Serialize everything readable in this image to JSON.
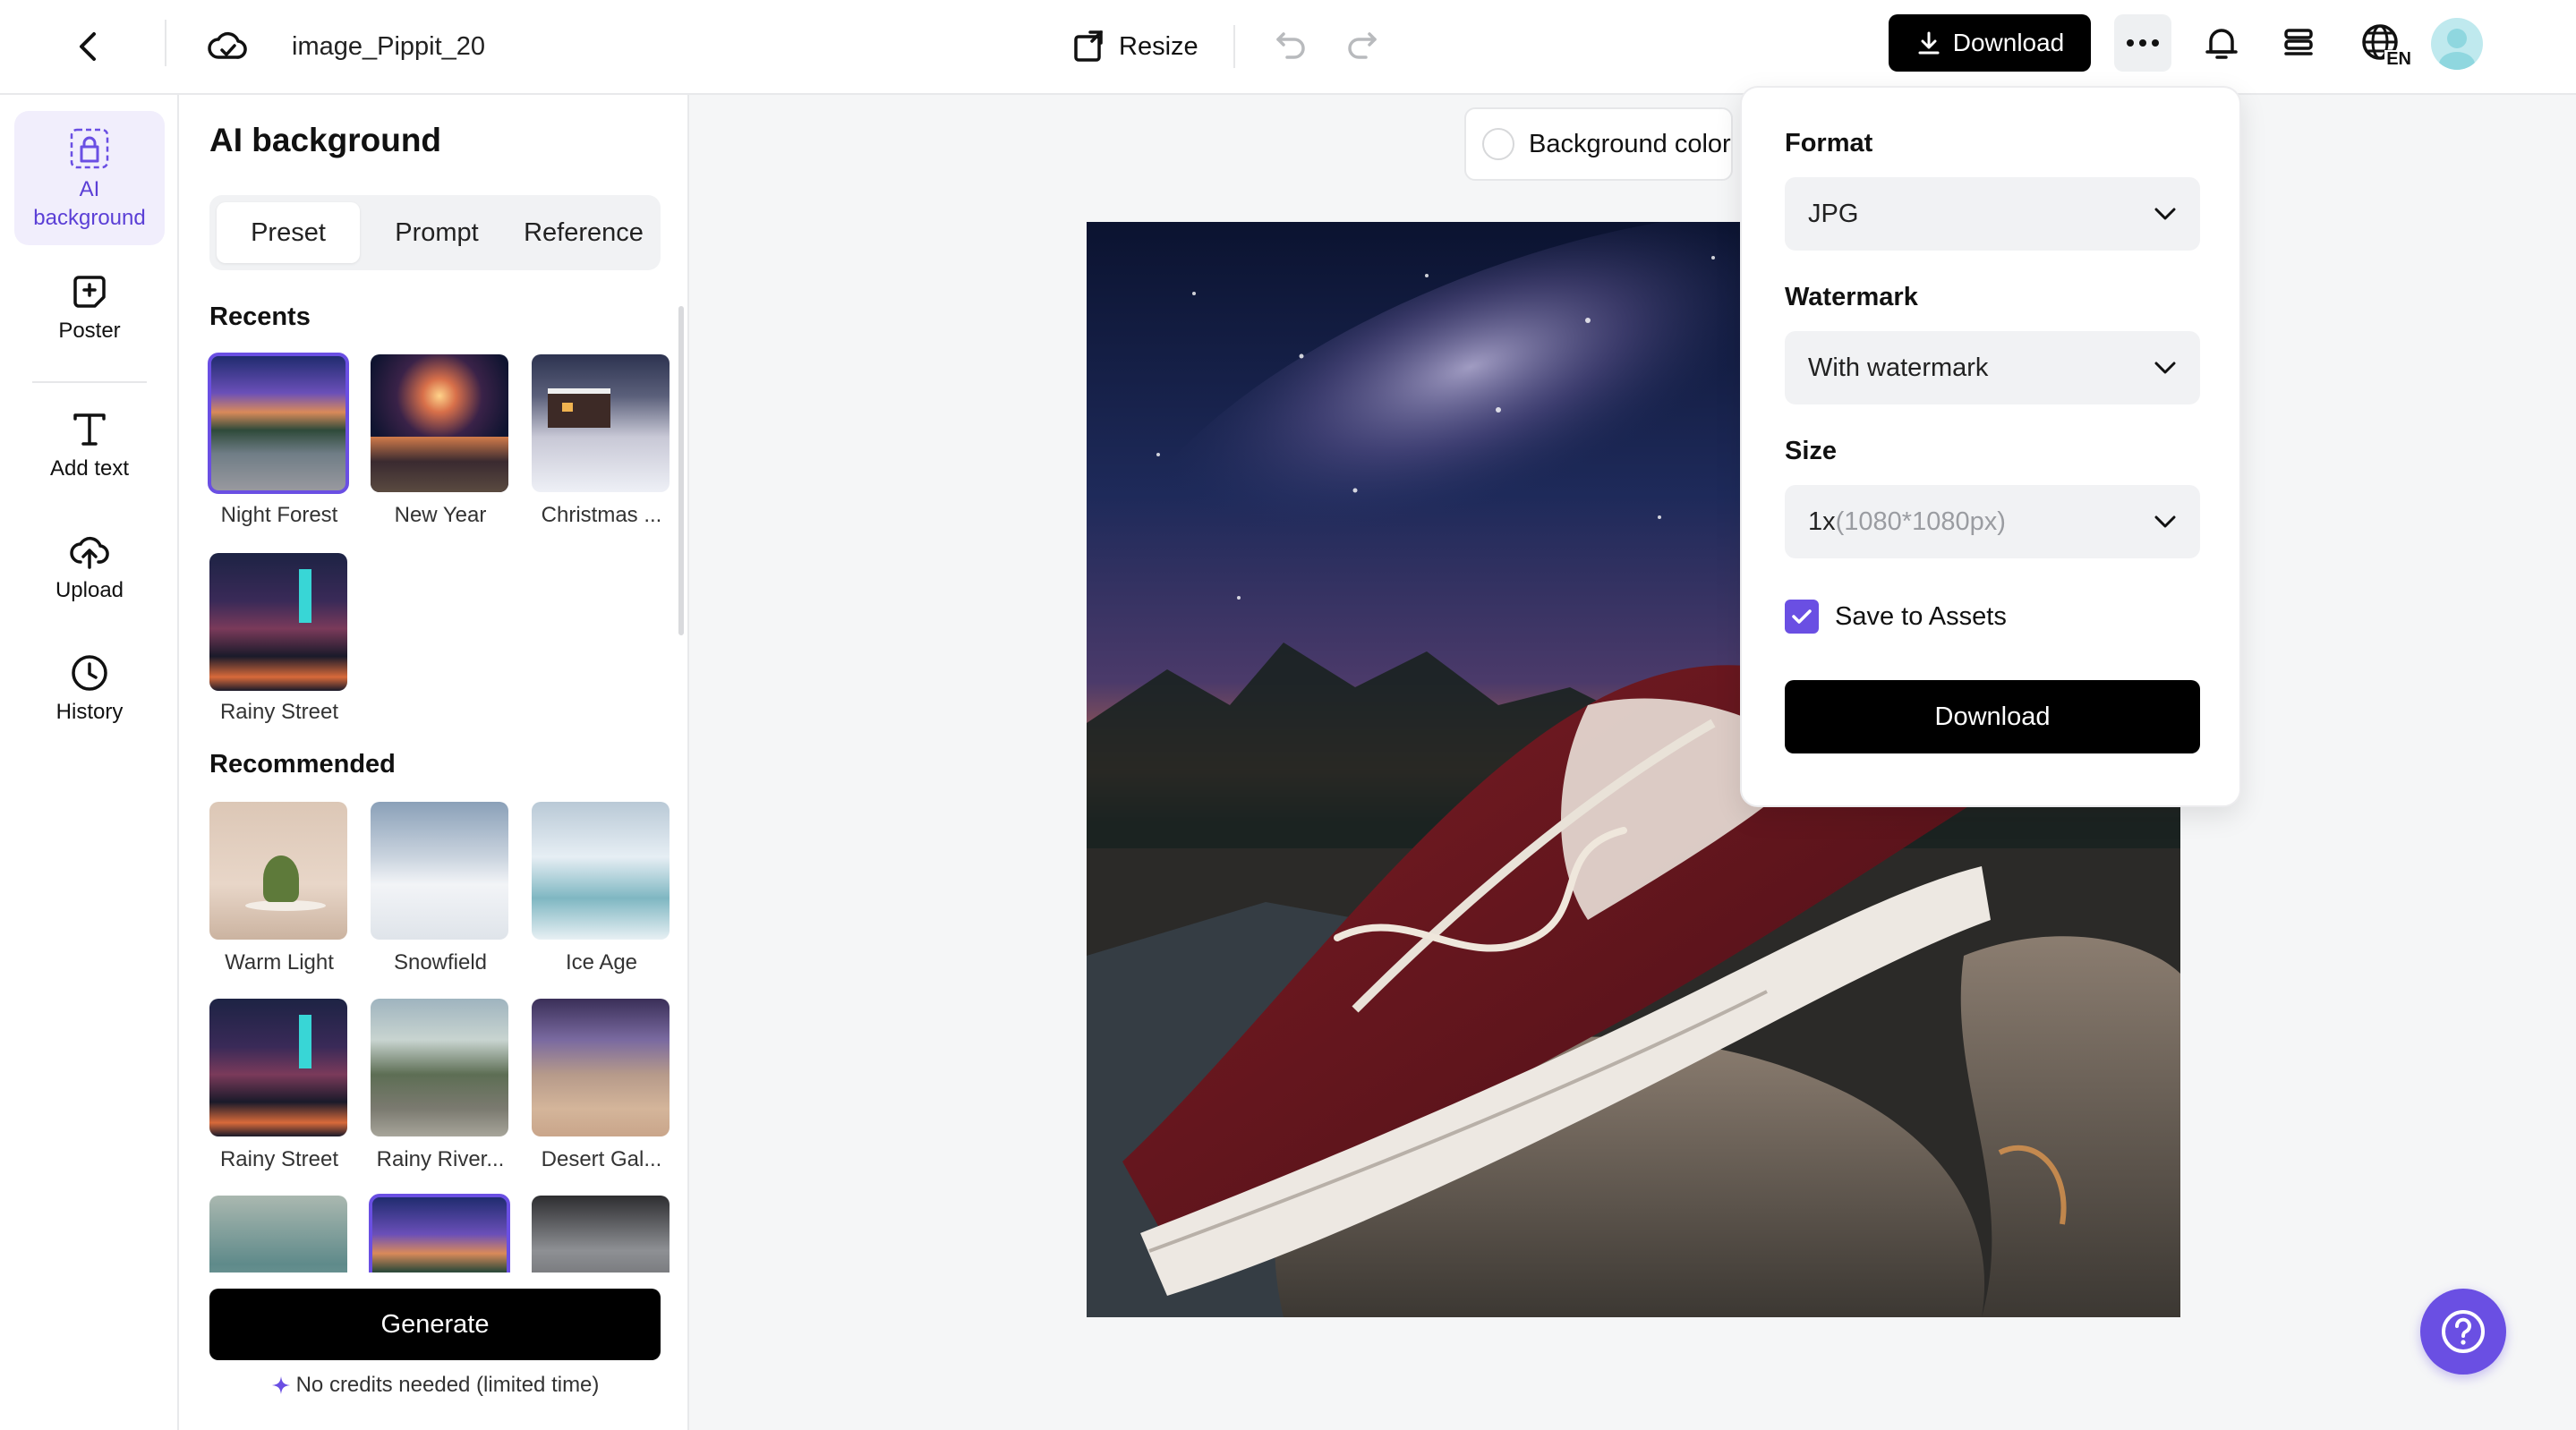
{
  "topbar": {
    "file_name": "image_Pippit_20",
    "resize_label": "Resize",
    "download_label": "Download",
    "lang_code": "EN"
  },
  "rail": {
    "items": [
      {
        "label": "AI background",
        "icon": "ai-background-icon",
        "active": true
      },
      {
        "label": "Poster",
        "icon": "poster-icon"
      },
      {
        "label": "Add text",
        "icon": "text-icon"
      },
      {
        "label": "Upload",
        "icon": "upload-cloud-icon"
      },
      {
        "label": "History",
        "icon": "clock-icon"
      }
    ]
  },
  "panel": {
    "title": "AI background",
    "tabs": [
      "Preset",
      "Prompt",
      "Reference"
    ],
    "active_tab": "Preset",
    "recents_heading": "Recents",
    "recents": [
      "Night Forest",
      "New Year",
      "Christmas ...",
      "Rainy Street"
    ],
    "recommended_heading": "Recommended",
    "recommended": [
      "Warm Light",
      "Snowfield",
      "Ice Age",
      "Rainy Street",
      "Rainy River...",
      "Desert Gal..."
    ],
    "generate_label": "Generate",
    "credits_note": "No credits needed (limited time)"
  },
  "canvas": {
    "background_color_label": "Background color"
  },
  "download_panel": {
    "format_label": "Format",
    "format_value": "JPG",
    "watermark_label": "Watermark",
    "watermark_value": "With watermark",
    "size_label": "Size",
    "size_value": "1x",
    "size_detail": "(1080*1080px)",
    "save_assets_label": "Save to Assets",
    "save_assets_checked": true,
    "download_button": "Download"
  },
  "colors": {
    "accent": "#6a4fe3",
    "primary_button": "#000000",
    "active_rail_bg": "#f1eefc"
  }
}
